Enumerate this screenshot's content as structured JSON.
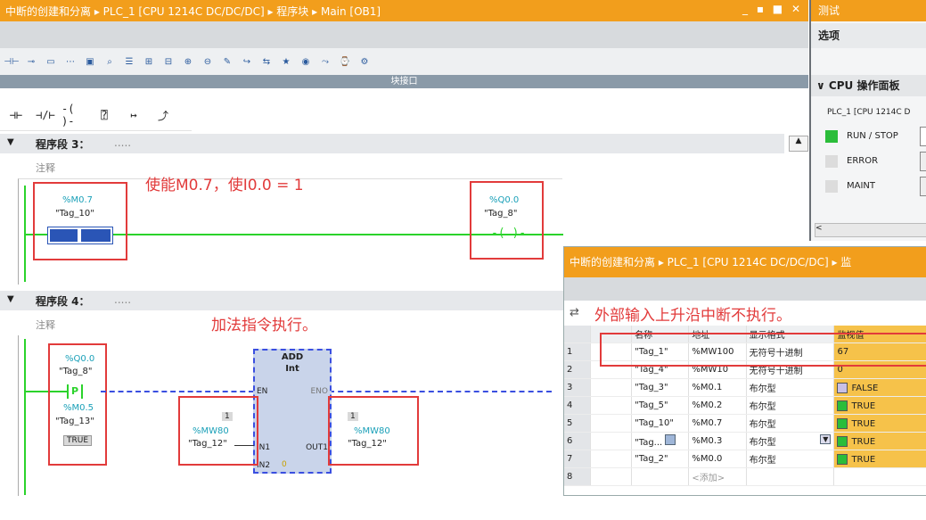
{
  "editor": {
    "title": "中断的创建和分离 ▸ PLC_1 [CPU 1214C DC/DC/DC] ▸ 程序块 ▸ Main [OB1]",
    "window_buttons": "_ ▪ ■ ✕",
    "interface_label": "块接口",
    "toolbar_icons": [
      "contact-icon",
      "coil-icon",
      "box-icon",
      "network-icon",
      "monitor-icon",
      "zoom-icon",
      "list-icon",
      "insert-icon",
      "delete-icon",
      "expand-icon",
      "collapse-icon",
      "comment-icon",
      "goto-icon",
      "absolute-icon",
      "favorites-icon",
      "breakpoint-icon",
      "step-icon",
      "watch-icon",
      "settings-icon"
    ],
    "instructions": [
      "⊣⊢",
      "⊣/⊢",
      "-(  )-",
      "⍰",
      "↦",
      "⤴"
    ]
  },
  "network3": {
    "header": "程序段 3：",
    "dots": ".....",
    "comment": "注释",
    "contact1_addr": "%M0.7",
    "contact1_tag": "\"Tag_10\"",
    "coil_addr": "%Q0.0",
    "coil_tag": "\"Tag_8\"",
    "annotation": "使能M0.7，使I0.0 = 1"
  },
  "network4": {
    "header": "程序段 4：",
    "dots": ".....",
    "comment": "注释",
    "contact_addr": "%Q0.0",
    "contact_tag": "\"Tag_8\"",
    "p_label": "P",
    "edge_addr": "%M0.5",
    "edge_tag": "\"Tag_13\"",
    "edge_value": "TRUE",
    "add_title": "ADD",
    "add_type": "Int",
    "en": "EN",
    "eno": "ENO",
    "in1": "IN1",
    "in2": "IN2",
    "in2_value": "0",
    "out1": "OUT1",
    "in_value": "1",
    "in_addr": "%MW80",
    "in_tag": "\"Tag_12\"",
    "out_value": "1",
    "out_addr": "%MW80",
    "out_tag": "\"Tag_12\"",
    "annotation": "加法指令执行。"
  },
  "test_panel": {
    "title": "测试",
    "options": "选项",
    "cpu_panel": "CPU 操作面板",
    "device": "PLC_1 [CPU 1214C D",
    "run_stop": "RUN / STOP",
    "error": "ERROR",
    "maint": "MAINT",
    "run_color": "#2bbd3a"
  },
  "watch": {
    "title": "中断的创建和分离 ▸ PLC_1 [CPU 1214C DC/DC/DC] ▸ 监",
    "annotation": "外部输入上升沿中断不执行。",
    "headers": [
      "",
      "",
      "名称",
      "地址",
      "显示格式",
      "监视值"
    ],
    "rows": [
      {
        "n": "1",
        "name": "\"Tag_1\"",
        "addr": "%MW100",
        "fmt": "无符号十进制",
        "val": "67",
        "chk": ""
      },
      {
        "n": "2",
        "name": "\"Tag_4\"",
        "addr": "%MW10",
        "fmt": "无符号十进制",
        "val": "0",
        "chk": ""
      },
      {
        "n": "3",
        "name": "\"Tag_3\"",
        "addr": "%M0.1",
        "fmt": "布尔型",
        "val": "FALSE",
        "chk": "off"
      },
      {
        "n": "4",
        "name": "\"Tag_5\"",
        "addr": "%M0.2",
        "fmt": "布尔型",
        "val": "TRUE",
        "chk": "on"
      },
      {
        "n": "5",
        "name": "\"Tag_10\"",
        "addr": "%M0.7",
        "fmt": "布尔型",
        "val": "TRUE",
        "chk": "on"
      },
      {
        "n": "6",
        "name": "\"Tag...",
        "addr": "%M0.3",
        "fmt": "布尔型",
        "val": "TRUE",
        "chk": "on"
      },
      {
        "n": "7",
        "name": "\"Tag_2\"",
        "addr": "%M0.0",
        "fmt": "布尔型",
        "val": "TRUE",
        "chk": "on"
      },
      {
        "n": "8",
        "name": "",
        "addr": "<添加>",
        "fmt": "",
        "val": "",
        "chk": ""
      }
    ]
  },
  "colors": {
    "accent": "#f29e1c",
    "power_flow": "#2bd32b",
    "highlight": "#e23b3b",
    "monitor_row": "#f6c24a"
  }
}
